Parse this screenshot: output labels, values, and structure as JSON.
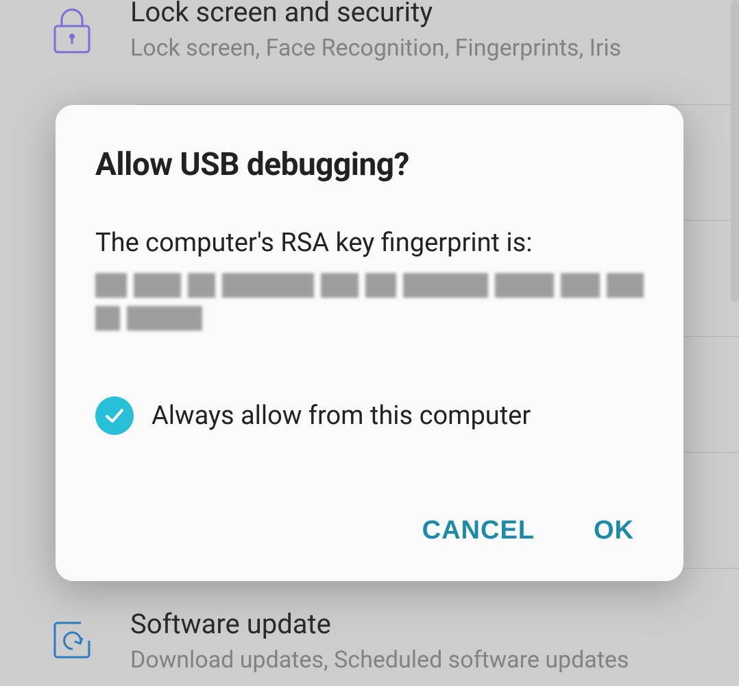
{
  "settings": {
    "items": [
      {
        "title": "Lock screen and security",
        "subtitle": "Lock screen, Face Recognition, Fingerprints, Iris",
        "icon": "lock-icon",
        "icon_color": "#7a6fd6"
      },
      {
        "title": "Software update",
        "subtitle": "Download updates, Scheduled software updates",
        "icon": "refresh-square-icon",
        "icon_color": "#2b7cc0"
      }
    ]
  },
  "dialog": {
    "title": "Allow USB debugging?",
    "body_intro": "The computer's RSA key fingerprint is:",
    "checkbox_label": "Always allow from this computer",
    "checkbox_checked": true,
    "actions": {
      "cancel": "CANCEL",
      "ok": "OK"
    }
  },
  "colors": {
    "accent": "#1c8aa8",
    "checkbox": "#27c0d8"
  }
}
